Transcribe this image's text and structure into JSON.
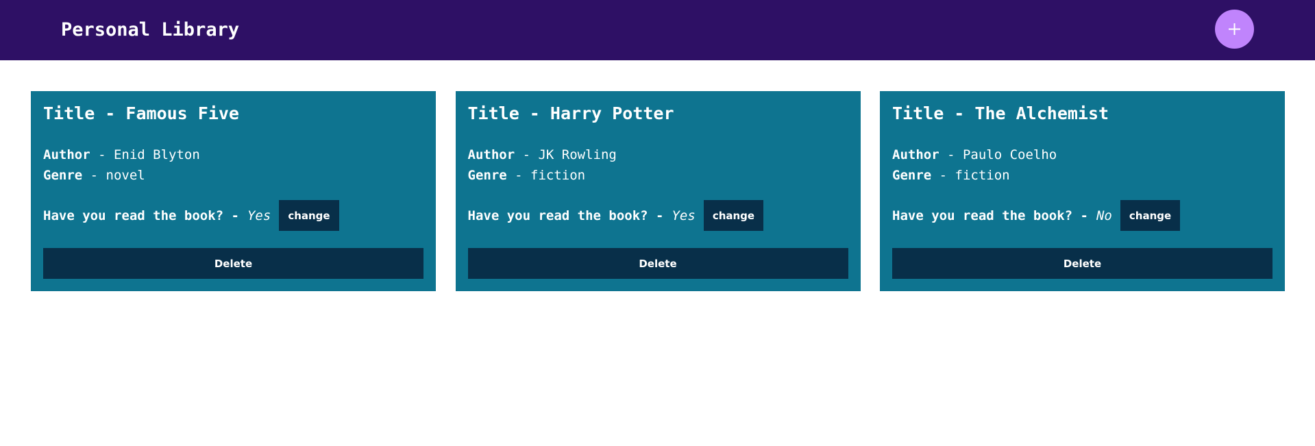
{
  "header": {
    "title": "Personal Library",
    "add_icon": "plus-icon"
  },
  "colors": {
    "header_bg": "#2e1065",
    "add_button": "#c084fc",
    "card_bg": "#0e7490",
    "button_bg": "#082f49"
  },
  "books": [
    {
      "title_label": "Title - ",
      "title": "Famous Five",
      "author_label": "Author",
      "author": "Enid Blyton",
      "genre_label": "Genre",
      "genre": "novel",
      "read_label": "Have you read the book? -",
      "read": "Yes",
      "change_label": "change",
      "delete_label": "Delete"
    },
    {
      "title_label": "Title - ",
      "title": "Harry Potter",
      "author_label": "Author",
      "author": "JK Rowling",
      "genre_label": "Genre",
      "genre": "fiction",
      "read_label": "Have you read the book? -",
      "read": "Yes",
      "change_label": "change",
      "delete_label": "Delete"
    },
    {
      "title_label": "Title - ",
      "title": "The Alchemist",
      "author_label": "Author",
      "author": "Paulo Coelho",
      "genre_label": "Genre",
      "genre": "fiction",
      "read_label": "Have you read the book? -",
      "read": "No",
      "change_label": "change",
      "delete_label": "Delete"
    }
  ]
}
